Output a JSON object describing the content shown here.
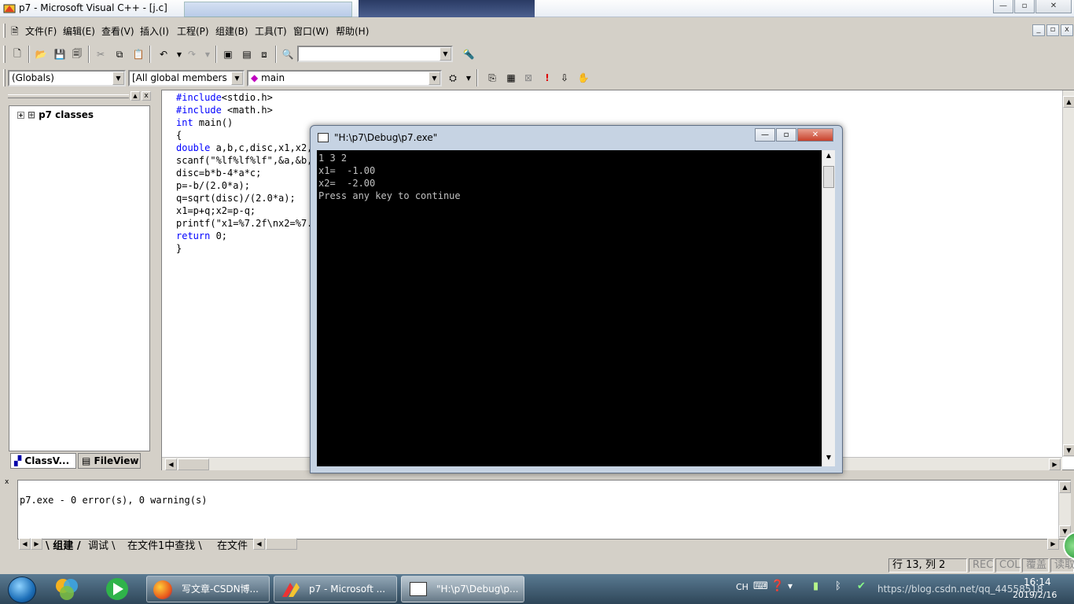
{
  "window": {
    "title": "p7 - Microsoft Visual C++ - [j.c]",
    "minimize": "—",
    "maximize": "▫",
    "close": "✕",
    "mdi_minimize": "_",
    "mdi_restore": "▫",
    "mdi_close": "x"
  },
  "menu": {
    "items": [
      "文件(F)",
      "编辑(E)",
      "查看(V)",
      "插入(I)",
      "工程(P)",
      "组建(B)",
      "工具(T)",
      "窗口(W)",
      "帮助(H)"
    ]
  },
  "toolbar": {
    "find_value": "",
    "scope_combo": "(Globals)",
    "members_combo": "[All global members",
    "function_combo": "main"
  },
  "workspace": {
    "tree_root": "p7 classes",
    "tabs": [
      "ClassV...",
      "FileView"
    ]
  },
  "editor": {
    "lines": [
      {
        "kw": "#include",
        "rest": "<stdio.h>"
      },
      {
        "kw": "#include",
        "rest": " <math.h>"
      },
      {
        "kw": "int",
        "rest": " main()"
      },
      {
        "kw": "",
        "rest": "{"
      },
      {
        "kw": "double",
        "rest": " a,b,c,disc,x1,x2,p,q;"
      },
      {
        "kw": "",
        "rest": "scanf(\"%lf%lf%lf\",&a,&b,&c);"
      },
      {
        "kw": "",
        "rest": "disc=b*b-4*a*c;"
      },
      {
        "kw": "",
        "rest": "p=-b/(2.0*a);"
      },
      {
        "kw": "",
        "rest": "q=sqrt(disc)/(2.0*a);"
      },
      {
        "kw": "",
        "rest": "x1=p+q;x2=p-q;"
      },
      {
        "kw": "",
        "rest": "printf(\"x1=%7.2f\\nx2=%7.2f\\n\",x1,x2);"
      },
      {
        "kw": "return",
        "rest": " 0;"
      },
      {
        "kw": "",
        "rest": "}"
      }
    ]
  },
  "console": {
    "title": "\"H:\\p7\\Debug\\p7.exe\"",
    "output": "1 3 2\nx1=  -1.00\nx2=  -2.00\nPress any key to continue"
  },
  "output_pane": {
    "text": "p7.exe - 0 error(s), 0 warning(s)",
    "tabs": [
      "组建",
      "调试",
      "在文件1中查找",
      "在文件"
    ]
  },
  "status": {
    "position": "行 13, 列 2",
    "rec": "REC",
    "col": "COL",
    "ovr": "覆盖",
    "read": "读取"
  },
  "taskbar": {
    "buttons": [
      "写文章-CSDN博...",
      "p7 - Microsoft ...",
      "\"H:\\p7\\Debug\\p..."
    ],
    "tray_lang": "CH",
    "clock_time": "16:14",
    "clock_date": "2019/2/16",
    "watermark": "https://blog.csdn.net/qq_44558518"
  }
}
